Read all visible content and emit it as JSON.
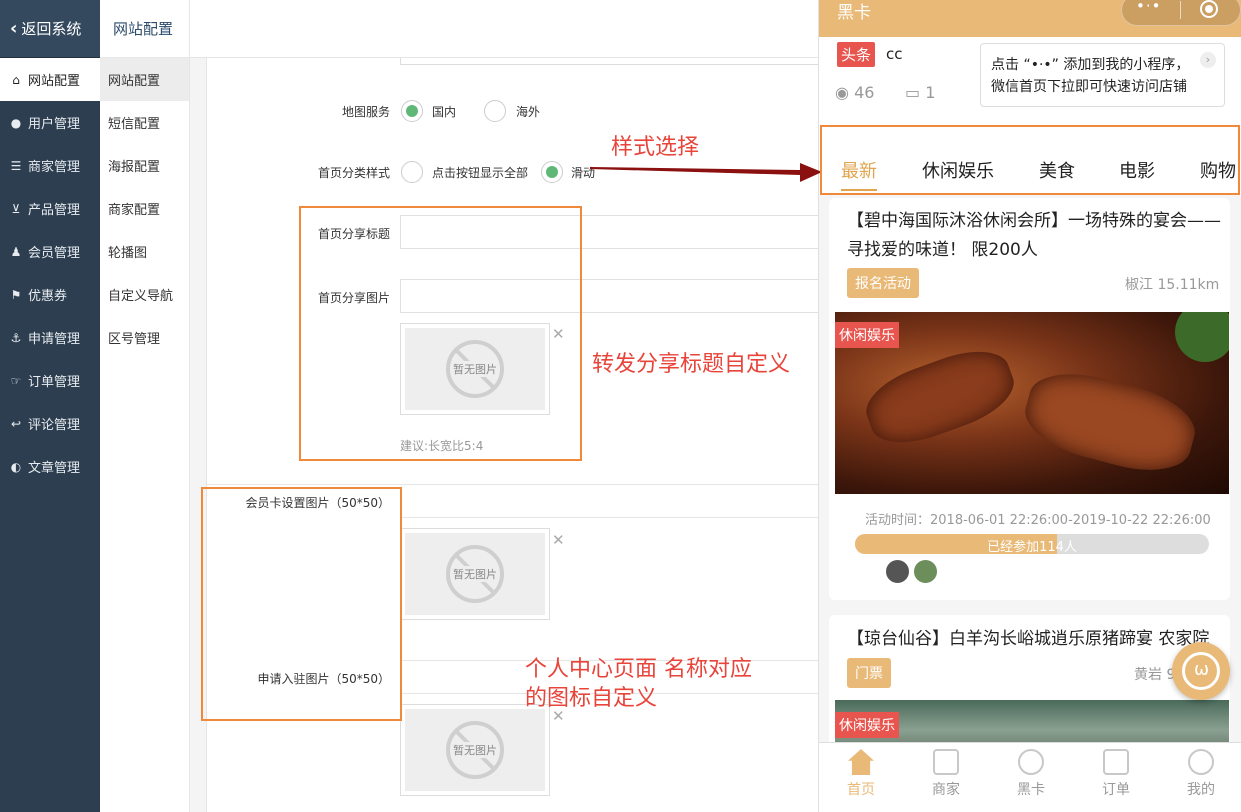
{
  "sidebar": {
    "back_label": "返回系统",
    "items": [
      {
        "label": "网站配置",
        "icon": "home-icon"
      },
      {
        "label": "用户管理",
        "icon": "user-icon"
      },
      {
        "label": "商家管理",
        "icon": "store-icon"
      },
      {
        "label": "产品管理",
        "icon": "cart-icon"
      },
      {
        "label": "会员管理",
        "icon": "member-icon"
      },
      {
        "label": "优惠券",
        "icon": "coupon-icon"
      },
      {
        "label": "申请管理",
        "icon": "anchor-icon"
      },
      {
        "label": "订单管理",
        "icon": "order-icon"
      },
      {
        "label": "评论管理",
        "icon": "reply-icon"
      },
      {
        "label": "文章管理",
        "icon": "article-icon"
      }
    ]
  },
  "subnav": {
    "header": "网站配置",
    "items": [
      "网站配置",
      "短信配置",
      "海报配置",
      "商家配置",
      "轮播图",
      "自定义导航",
      "区号管理"
    ]
  },
  "form": {
    "map_service": {
      "label": "地图服务",
      "options": [
        "国内",
        "海外"
      ],
      "selected": "国内"
    },
    "category_style": {
      "label": "首页分类样式",
      "options": [
        "点击按钮显示全部",
        "滑动"
      ],
      "selected": "滑动"
    },
    "share_title": {
      "label": "首页分享标题",
      "value": ""
    },
    "share_image": {
      "label": "首页分享图片",
      "placeholder": "暂无图片",
      "hint": "建议:长宽比5:4"
    },
    "member_card_image": {
      "label": "会员卡设置图片（50*50）",
      "placeholder": "暂无图片"
    },
    "apply_image": {
      "label": "申请入驻图片（50*50）",
      "placeholder": "暂无图片"
    }
  },
  "annotations": {
    "style_select": "样式选择",
    "share_custom": "转发分享标题自定义",
    "personal_center_line1": "个人中心页面  名称对应",
    "personal_center_line2": "的图标自定义"
  },
  "phone": {
    "title": "黑卡",
    "headline_tag": "头条",
    "headline_text": "cc",
    "views": "46",
    "comments": "1",
    "tip_line1": "点击 “•·•” 添加到我的小程序，",
    "tip_line2": "微信首页下拉即可快速访问店铺",
    "tabs": [
      "最新",
      "休闲娱乐",
      "美食",
      "电影",
      "购物"
    ],
    "active_tab": "最新",
    "cards": [
      {
        "title": "【碧中海国际沐浴休闲会所】一场特殊的宴会——寻找爱的味道！ 限200人",
        "button": "报名活动",
        "location": "椒江 15.11km",
        "category": "休闲娱乐",
        "time": "活动时间：2018-06-01 22:26:00-2019-10-22 22:26:00",
        "joined": "已经参加114人",
        "progress": 0.57
      },
      {
        "title": "【琼台仙谷】白羊沟长峪城逍乐原猪蹄宴 农家院",
        "button": "门票",
        "location": "黄岩 9",
        "category": "休闲娱乐"
      }
    ],
    "tabbar": [
      "首页",
      "商家",
      "黑卡",
      "订单",
      "我的"
    ],
    "colors": {
      "accent": "#e9b977",
      "red": "#e8544e",
      "annotation": "#e8443a",
      "box": "#f08a3a"
    }
  }
}
